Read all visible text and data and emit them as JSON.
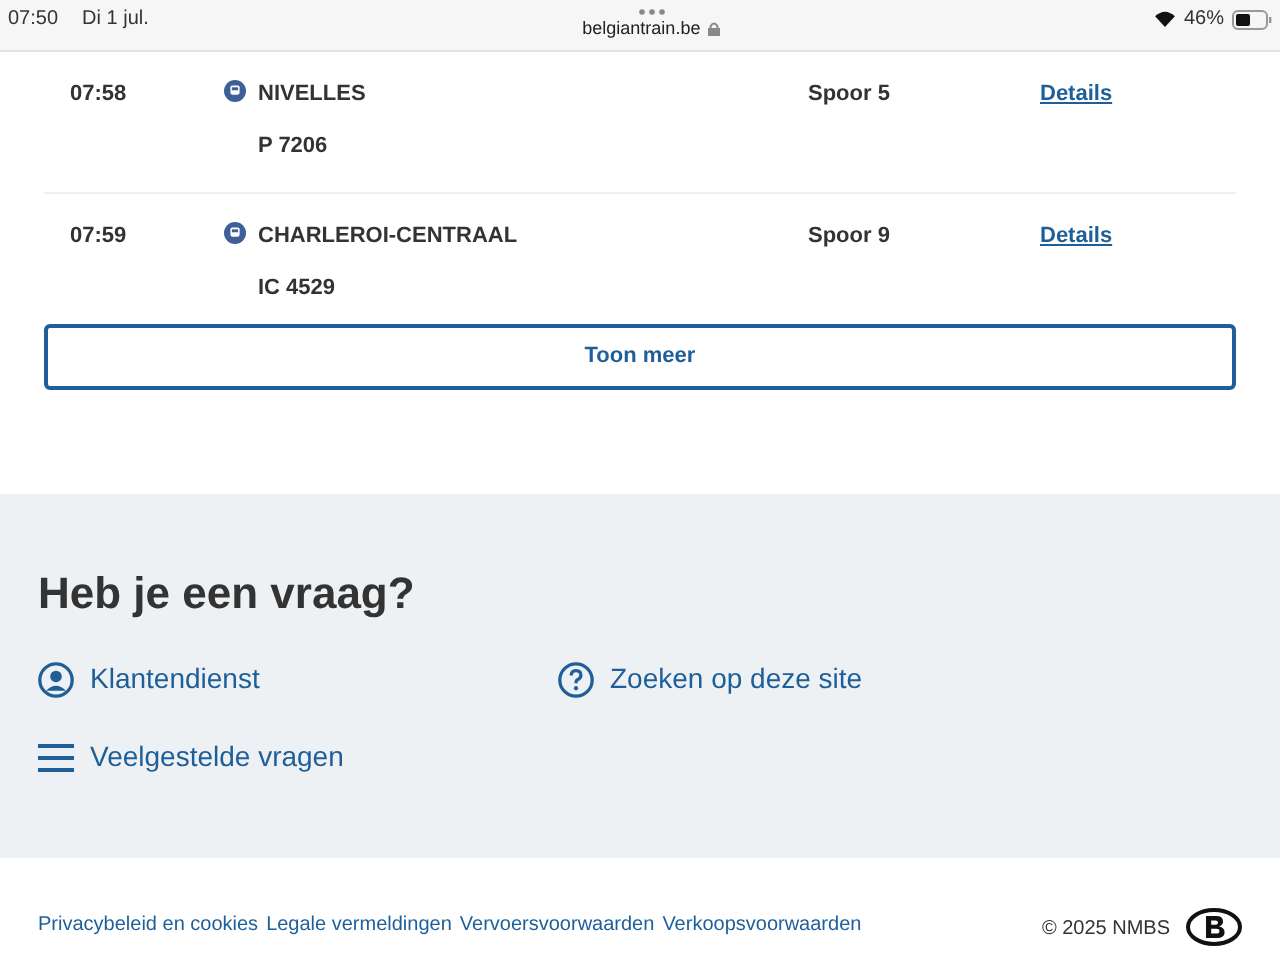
{
  "status_bar": {
    "time": "07:50",
    "date": "Di 1 jul.",
    "url": "belgiantrain.be",
    "battery": "46%"
  },
  "departures": [
    {
      "time": "07:58",
      "destination": "NIVELLES",
      "train": "P 7206",
      "platform": "Spoor 5",
      "link": "Details"
    },
    {
      "time": "07:59",
      "destination": "CHARLEROI-CENTRAAL",
      "train": "IC 4529",
      "platform": "Spoor 9",
      "link": "Details"
    }
  ],
  "more_button": "Toon meer",
  "help": {
    "title": "Heb je een vraag?",
    "links": [
      {
        "kind": "person",
        "label": "Klantendienst"
      },
      {
        "kind": "question",
        "label": "Zoeken op deze site"
      },
      {
        "kind": "menu",
        "label": "Veelgestelde vragen"
      }
    ]
  },
  "footer": {
    "links": [
      "Privacybeleid en cookies",
      "Legale vermeldingen",
      "Vervoersvoorwaarden",
      "Verkoopsvoorwaarden"
    ],
    "copyright": "© 2025 NMBS"
  }
}
